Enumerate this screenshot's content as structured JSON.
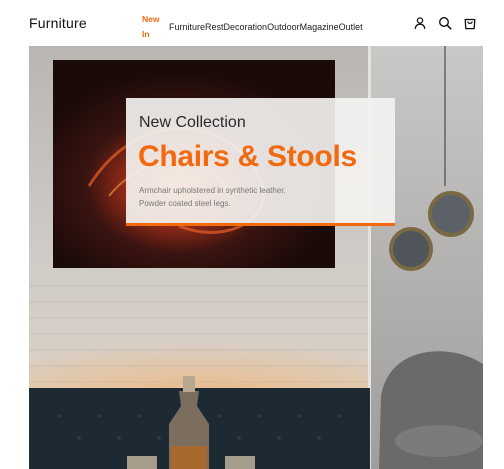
{
  "header": {
    "logo": "Furniture",
    "nav": [
      {
        "label": "New In",
        "active": true
      },
      {
        "label": "Furniture",
        "active": false
      },
      {
        "label": "Rest",
        "active": false
      },
      {
        "label": "Decoration",
        "active": false
      },
      {
        "label": "Outdoor",
        "active": false
      },
      {
        "label": "Magazine",
        "active": false
      },
      {
        "label": "Outlet",
        "active": false
      }
    ],
    "icons": [
      "user-icon",
      "search-icon",
      "cart-icon"
    ]
  },
  "hero": {
    "eyebrow": "New Collection",
    "title": "Chairs & Stools",
    "description_line1": "Armchair upholstered in synthetic leather.",
    "description_line2": "Powder coated steel legs."
  },
  "colors": {
    "accent": "#f26a10",
    "text": "#111111"
  }
}
